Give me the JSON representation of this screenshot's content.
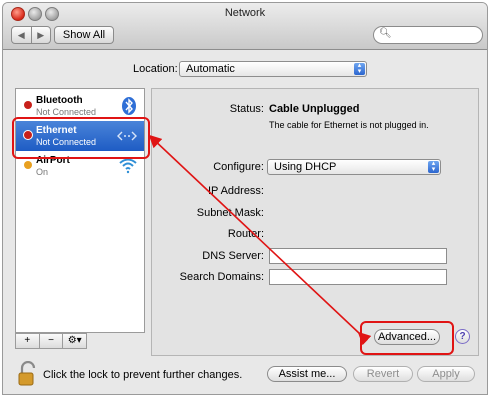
{
  "window": {
    "title": "Network"
  },
  "toolbar": {
    "show_all": "Show All",
    "back_icon": "chevron-left-icon",
    "forward_icon": "chevron-right-icon"
  },
  "location": {
    "label": "Location:",
    "value": "Automatic"
  },
  "services": [
    {
      "name": "Bluetooth",
      "status": "Not Connected",
      "status_color": "#c8201a",
      "icon": "bluetooth-icon"
    },
    {
      "name": "Ethernet",
      "status": "Not Connected",
      "status_color": "#c8201a",
      "icon": "ethernet-icon"
    },
    {
      "name": "AirPort",
      "status": "On",
      "status_color": "#e8a020",
      "icon": "wifi-icon"
    }
  ],
  "sidebar_tools": {
    "add": "+",
    "remove": "−",
    "action": "⚙▾"
  },
  "details": {
    "status_label": "Status:",
    "status_value": "Cable Unplugged",
    "status_desc": "The cable for Ethernet is not plugged in.",
    "configure_label": "Configure:",
    "configure_value": "Using DHCP",
    "ip_label": "IP Address:",
    "subnet_label": "Subnet Mask:",
    "router_label": "Router:",
    "dns_label": "DNS Server:",
    "search_domains_label": "Search Domains:",
    "dns_value": "",
    "search_domains_value": ""
  },
  "buttons": {
    "advanced": "Advanced...",
    "help": "?",
    "assist": "Assist me...",
    "revert": "Revert",
    "apply": "Apply"
  },
  "footer": {
    "lock_text": "Click the lock to prevent further changes."
  },
  "colors": {
    "selection": "#1e5cc4",
    "annotation": "#e01414",
    "popup_accent": "#2c66cf"
  }
}
